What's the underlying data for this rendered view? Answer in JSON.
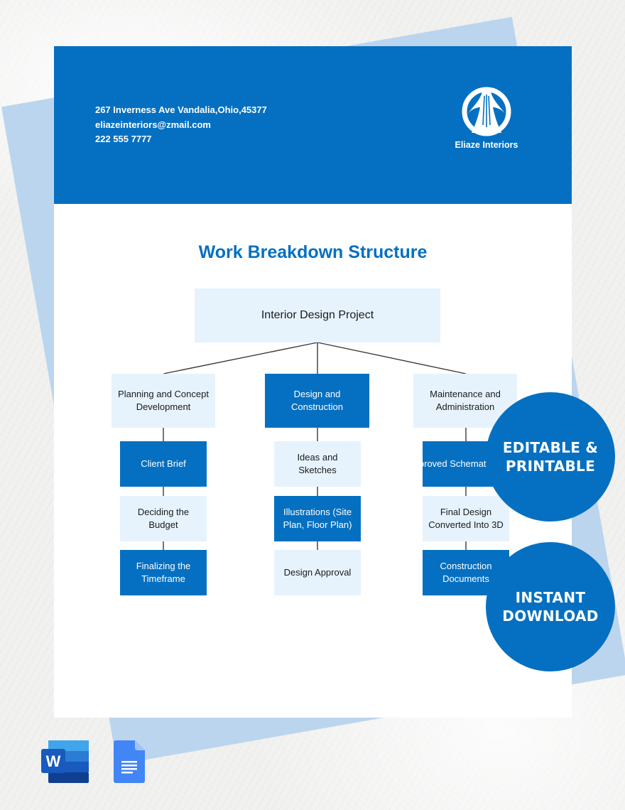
{
  "header": {
    "address": "267 Inverness Ave Vandalia,Ohio,45377",
    "email": "eliazeinteriors@zmail.com",
    "phone": "222 555 7777",
    "company_name": "Eliaze Interiors",
    "logo_icon": "arch-road-logo-icon"
  },
  "title": "Work Breakdown Structure",
  "wbs": {
    "root": "Interior Design Project",
    "branches": [
      {
        "label": "Planning and Concept Development",
        "children": [
          "Client Brief",
          "Deciding the Budget",
          "Finalizing the Timeframe"
        ]
      },
      {
        "label": "Design and Construction",
        "children": [
          "Ideas and Sketches",
          "Illustrations (Site Plan, Floor Plan)",
          "Design Approval"
        ]
      },
      {
        "label": "Maintenance and Administration",
        "children": [
          "Approved Schematic Design",
          "Final Design Converted Into 3D",
          "Construction Documents"
        ]
      }
    ]
  },
  "badges": {
    "editable": "EDITABLE & PRINTABLE",
    "download": "INSTANT DOWNLOAD"
  },
  "formats": [
    {
      "name": "Microsoft Word",
      "icon": "word-icon"
    },
    {
      "name": "Google Docs",
      "icon": "google-docs-icon"
    }
  ],
  "colors": {
    "brand_blue": "#0570c1",
    "light_box": "#e6f3fd",
    "backing_sheet": "#bcd5ee"
  }
}
